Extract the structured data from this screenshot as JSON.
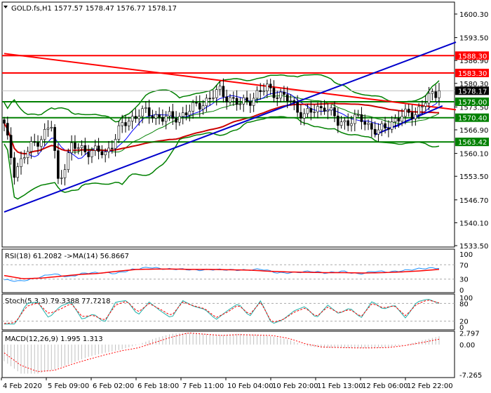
{
  "header": {
    "symbol": "GOLD.fs,H1",
    "ohlc": "1577.57 1578.47 1576.77 1578.17"
  },
  "chart_data": [
    {
      "type": "candlestick",
      "title": "GOLD.fs,H1",
      "ylim": [
        1533.5,
        1600.3
      ],
      "y_ticks": [
        "1600.30",
        "1593.50",
        "1586.90",
        "1580.30",
        "1573.50",
        "1566.90",
        "1560.10",
        "1553.50",
        "1546.70",
        "1540.10",
        "1533.50"
      ],
      "x_ticks": [
        "4 Feb 2020",
        "5 Feb 09:00",
        "6 Feb 02:00",
        "6 Feb 18:00",
        "7 Feb 11:00",
        "10 Feb 04:00",
        "10 Feb 20:00",
        "11 Feb 13:00",
        "12 Feb 06:00",
        "12 Feb 22:00"
      ],
      "bars": 130,
      "close_path": [
        [
          0,
          1568
        ],
        [
          3,
          1555
        ],
        [
          8,
          1562
        ],
        [
          14,
          1568
        ],
        [
          16,
          1552
        ],
        [
          20,
          1562
        ],
        [
          30,
          1560
        ],
        [
          35,
          1568
        ],
        [
          40,
          1572
        ],
        [
          50,
          1570
        ],
        [
          56,
          1573
        ],
        [
          64,
          1578
        ],
        [
          70,
          1574
        ],
        [
          78,
          1579
        ],
        [
          85,
          1575
        ],
        [
          89,
          1571
        ],
        [
          95,
          1574
        ],
        [
          99,
          1569
        ],
        [
          106,
          1570
        ],
        [
          111,
          1566
        ],
        [
          116,
          1570
        ],
        [
          122,
          1572
        ],
        [
          126,
          1576
        ],
        [
          129,
          1578.17
        ]
      ],
      "levels": [
        {
          "price": "1588.30",
          "color": "#ff0000"
        },
        {
          "price": "1583.30",
          "color": "#ff0000"
        },
        {
          "price": "1575.00",
          "color": "#008000"
        },
        {
          "price": "1570.40",
          "color": "#008000"
        },
        {
          "price": "1563.42",
          "color": "#008000"
        }
      ],
      "current_price": "1578.17",
      "trendlines": [
        {
          "name": "resistance-downtrend",
          "color": "#ff0000",
          "from": [
            0,
            1588.9
          ],
          "to": [
            134,
            1572.7
          ]
        },
        {
          "name": "support-uptrend",
          "color": "#0000cc",
          "from": [
            0,
            1543.2
          ],
          "to": [
            134,
            1592.2
          ]
        },
        {
          "name": "short-channel",
          "color": "#0000cc",
          "from": [
            110,
            1565.5
          ],
          "to": [
            130,
            1573.8
          ]
        }
      ]
    },
    {
      "type": "line",
      "title": "RSI(18) 61.2082  ->MA(14) 56.8667",
      "ylim": [
        0,
        100
      ],
      "y_ticks": [
        "100",
        "70",
        "30",
        "0"
      ],
      "series": [
        {
          "name": "RSI",
          "color": "#1e90ff",
          "values": [
            28,
            24,
            33,
            45,
            36,
            47,
            48,
            46,
            57,
            63,
            58,
            58,
            55,
            57,
            56,
            55,
            58,
            47,
            48,
            52,
            47,
            52,
            44,
            52,
            50,
            55,
            60,
            61
          ]
        },
        {
          "name": "MA",
          "color": "#ff0000",
          "values": [
            40,
            31,
            33,
            38,
            43,
            46,
            52,
            57,
            58,
            58,
            57,
            57,
            56,
            55,
            52,
            50,
            49,
            48,
            48,
            47,
            48,
            50,
            53,
            57
          ]
        }
      ]
    },
    {
      "type": "line",
      "title": "Stoch(5,3,3) 79.3388 77.7218",
      "ylim": [
        0,
        100
      ],
      "y_ticks": [
        "100",
        "80",
        "20",
        "0"
      ],
      "series": [
        {
          "name": "%K",
          "color": "#20b2aa",
          "values": [
            10,
            10,
            80,
            85,
            30,
            70,
            85,
            25,
            45,
            15,
            85,
            90,
            40,
            85,
            55,
            30,
            90,
            70,
            60,
            25,
            55,
            80,
            35,
            90,
            10,
            25,
            55,
            70,
            30,
            75,
            45,
            65,
            30,
            88,
            60,
            75,
            30,
            85,
            95,
            80
          ]
        },
        {
          "name": "%D",
          "color": "#ff0000",
          "values": [
            12,
            15,
            70,
            82,
            45,
            60,
            80,
            35,
            40,
            22,
            75,
            88,
            50,
            80,
            60,
            38,
            85,
            72,
            62,
            32,
            50,
            75,
            42,
            85,
            15,
            25,
            50,
            65,
            35,
            68,
            48,
            60,
            35,
            80,
            65,
            72,
            38,
            78,
            92,
            82
          ]
        }
      ]
    },
    {
      "type": "bar",
      "title": "MACD(12,26,9) 1.995 1.313",
      "ylim": [
        -7.265,
        2.797
      ],
      "y_ticks": [
        "2.797",
        "0.00",
        "-7.265"
      ],
      "series": [
        {
          "name": "MACD",
          "color": "#c0c0c0",
          "values": [
            -4,
            -7,
            -7,
            -6,
            -4.5,
            -3,
            -2,
            -1.2,
            0,
            1.5,
            2.6,
            2.9,
            2.6,
            2.3,
            2.6,
            2.4,
            2.0,
            1.2,
            -0.3,
            -0.8,
            -0.8,
            -0.8,
            -0.9,
            -0.6,
            0,
            1,
            2.0
          ]
        },
        {
          "name": "Signal",
          "color": "#ff0000",
          "values": [
            -2,
            -5,
            -6.5,
            -6.2,
            -4.8,
            -3.6,
            -2.5,
            -1.5,
            -0.8,
            0.5,
            1.8,
            2.8,
            2.5,
            2.2,
            2.4,
            2.3,
            2.2,
            1.5,
            0.2,
            -0.6,
            -0.7,
            -0.8,
            -0.8,
            -0.7,
            -0.2,
            0.5,
            1.3
          ]
        }
      ]
    }
  ]
}
